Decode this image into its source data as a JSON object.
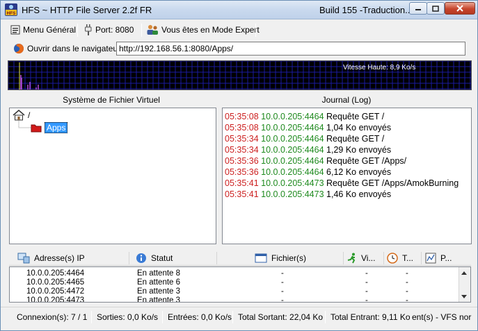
{
  "window": {
    "title": "HFS ~ HTTP File Server 2.2f FR",
    "title_right": "Build 155  -Traduction...",
    "icon_text": "HFS"
  },
  "toolbar": {
    "menu_label": "Menu Général",
    "port_label": "Port: 8080",
    "mode_label": "Vous êtes en Mode Expert"
  },
  "address": {
    "browser_label": "Ouvrir dans le navigateur",
    "url": "http://192.168.56.1:8080/Apps/"
  },
  "graph": {
    "speed_label": "Vitesse Haute: 8,9 Ko/s",
    "grid_color": "#1a1aa0",
    "bar_color": "#b04ad8"
  },
  "vfs": {
    "caption": "Système de Fichier Virtuel",
    "root_label": "/",
    "folder_label": "Apps"
  },
  "log": {
    "caption": "Journal (Log)",
    "entries": [
      {
        "time": "05:35:08",
        "ip": "10.0.0.205:4464",
        "msg": "Requête GET /"
      },
      {
        "time": "05:35:08",
        "ip": "10.0.0.205:4464",
        "msg": "1,04 Ko envoyés"
      },
      {
        "time": "05:35:34",
        "ip": "10.0.0.205:4464",
        "msg": "Requête GET /"
      },
      {
        "time": "05:35:34",
        "ip": "10.0.0.205:4464",
        "msg": "1,29 Ko envoyés"
      },
      {
        "time": "05:35:36",
        "ip": "10.0.0.205:4464",
        "msg": "Requête GET /Apps/"
      },
      {
        "time": "05:35:36",
        "ip": "10.0.0.205:4464",
        "msg": "6,12 Ko envoyés"
      },
      {
        "time": "05:35:41",
        "ip": "10.0.0.205:4473",
        "msg": "Requête GET /Apps/AmokBurning"
      },
      {
        "time": "05:35:41",
        "ip": "10.0.0.205:4473",
        "msg": "1,46 Ko envoyés"
      }
    ]
  },
  "connections": {
    "headers": {
      "ip": "Adresse(s) IP",
      "status": "Statut",
      "file": "Fichier(s)",
      "speed": "Vi...",
      "time": "T...",
      "progress": "P..."
    },
    "rows": [
      {
        "ip": "10.0.0.205:4464",
        "status": "En attente 8",
        "file": "-",
        "speed": "-",
        "time": "-"
      },
      {
        "ip": "10.0.0.205:4465",
        "status": "En attente 6",
        "file": "-",
        "speed": "-",
        "time": "-"
      },
      {
        "ip": "10.0.0.205:4472",
        "status": "En attente 3",
        "file": "-",
        "speed": "-",
        "time": "-"
      },
      {
        "ip": "10.0.0.205:4473",
        "status": "En attente 3",
        "file": "-",
        "speed": "-",
        "time": "-"
      }
    ]
  },
  "status": {
    "connections": "Connexion(s): 7 / 1",
    "out_speed": "Sorties: 0,0 Ko/s",
    "in_speed": "Entrées: 0,0 Ko/s",
    "total_out": "Total Sortant: 22,04 Ko",
    "total_in": "Total Entrant: 9,11 Ko",
    "vfs": "ent(s) - VFS nor"
  }
}
